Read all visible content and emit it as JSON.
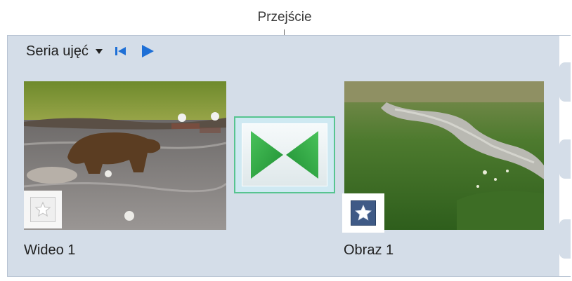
{
  "callout": {
    "label": "Przejście"
  },
  "toolbar": {
    "series_label": "Seria ujęć",
    "icons": [
      "dropdown-arrow-icon",
      "skip-to-start-icon",
      "play-icon"
    ],
    "accent": "#1e6fd6"
  },
  "clips": [
    {
      "caption": "Wideo 1",
      "type": "video",
      "star": "disabled"
    },
    {
      "caption": "Obraz 1",
      "type": "image",
      "star": "enabled"
    }
  ],
  "transition": {
    "icon": "transition-icon",
    "color": "#2fae4a",
    "border": "#57c490"
  },
  "colors": {
    "panel": "#d4dde8"
  }
}
